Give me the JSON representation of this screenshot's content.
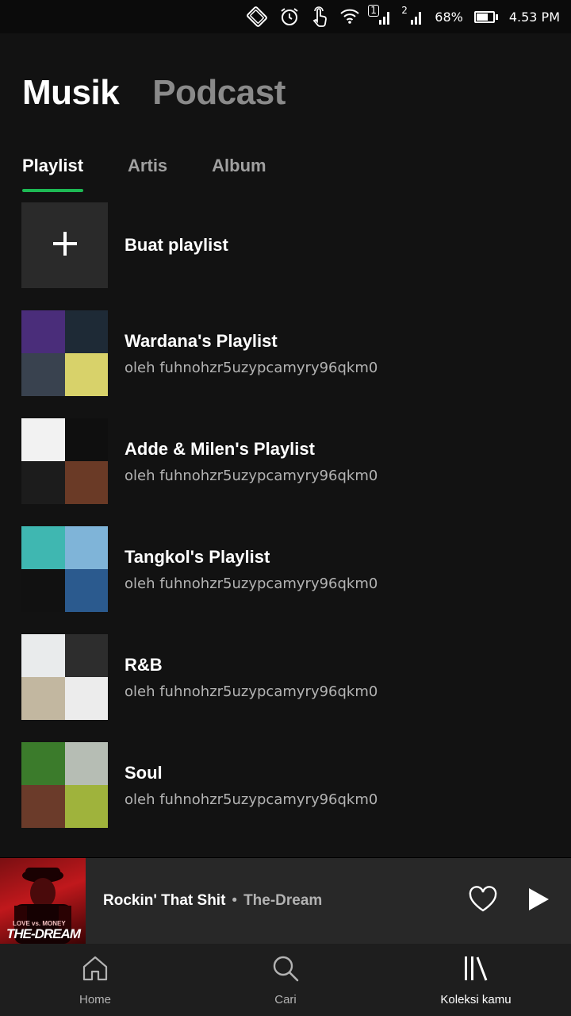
{
  "statusbar": {
    "sim1": "1",
    "sim2": "2",
    "battery": "68%",
    "battery_level": 0.68,
    "time": "4.53 PM"
  },
  "top_tabs": {
    "music": "Musik",
    "podcast": "Podcast"
  },
  "sub_tabs": {
    "playlist": "Playlist",
    "artists": "Artis",
    "album": "Album"
  },
  "accent_color": "#1db954",
  "create_playlist": {
    "label": "Buat playlist"
  },
  "playlists": [
    {
      "title": "Wardana's Playlist",
      "subtitle": "oleh fuhnohzr5uzypcamyry96qkm0",
      "colors": [
        "#4a2d7a",
        "#1e2a36",
        "#39424f",
        "#d8d26a"
      ]
    },
    {
      "title": "Adde & Milen's Playlist",
      "subtitle": "oleh fuhnohzr5uzypcamyry96qkm0",
      "colors": [
        "#f2f2f2",
        "#0f0f0f",
        "#1c1c1c",
        "#6a3a26"
      ]
    },
    {
      "title": "Tangkol's Playlist",
      "subtitle": "oleh fuhnohzr5uzypcamyry96qkm0",
      "colors": [
        "#3fb7b1",
        "#7fb4d8",
        "#111111",
        "#2b5a8e"
      ]
    },
    {
      "title": "R&B",
      "subtitle": "oleh fuhnohzr5uzypcamyry96qkm0",
      "colors": [
        "#e9ebec",
        "#2d2d2d",
        "#c2b7a0",
        "#ececec"
      ]
    },
    {
      "title": "Soul",
      "subtitle": "oleh fuhnohzr5uzypcamyry96qkm0",
      "colors": [
        "#3b7b2b",
        "#b6bdb4",
        "#6b3b2a",
        "#9fb33c"
      ]
    }
  ],
  "now_playing": {
    "title": "Rockin' That Shit",
    "separator": "•",
    "artist": "The-Dream",
    "art_text_small": "LOVE vs. MONEY",
    "art_text_big": "THE-DREAM"
  },
  "bottom_nav": {
    "home": "Home",
    "search": "Cari",
    "library": "Koleksi kamu"
  }
}
